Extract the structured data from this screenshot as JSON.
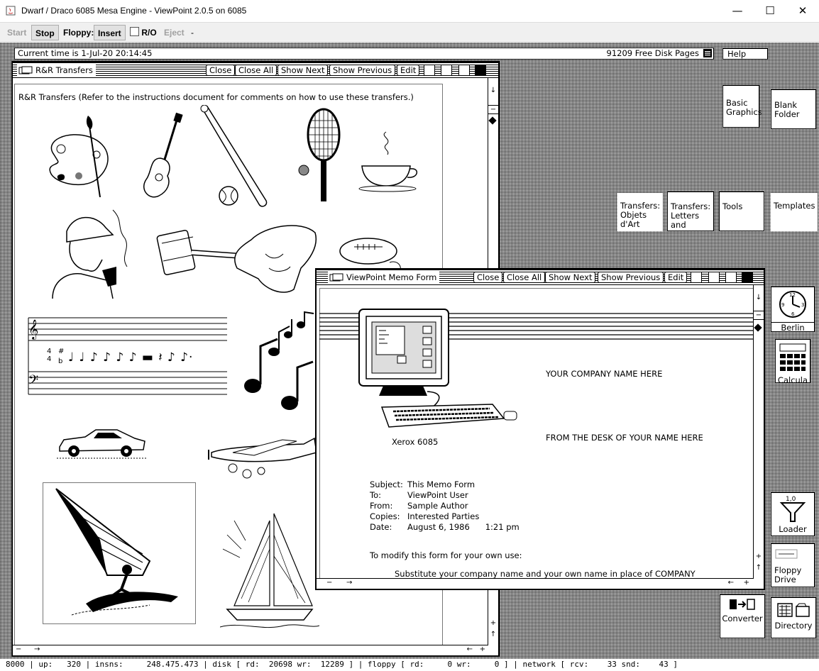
{
  "window": {
    "title": "Dwarf / Draco 6085 Mesa Engine - ViewPoint 2.0.5 on 6085",
    "controls": [
      "—",
      "☐",
      "✕"
    ]
  },
  "toolbar": {
    "start": "Start",
    "stop": "Stop",
    "floppy_label": "Floppy:",
    "insert": "Insert",
    "ro": "R/O",
    "eject": "Eject",
    "dash": "-"
  },
  "status": {
    "time": "Current time is 1-Jul-20 20:14:45",
    "disk": "91209 Free Disk Pages"
  },
  "help_tab": "Help",
  "rr_window": {
    "title": "R&R Transfers",
    "buttons": [
      "Close",
      "Close All",
      "Show Next",
      "Show Previous",
      "Edit"
    ],
    "heading": "R&R Transfers   (Refer to the instructions document for comments on how to use these transfers.)"
  },
  "memo_window": {
    "title": "ViewPoint Memo Form",
    "buttons": [
      "Close",
      "Close All",
      "Show Next",
      "Show Previous",
      "Edit"
    ],
    "company": "YOUR COMPANY NAME HERE",
    "from_desk": "FROM THE DESK OF YOUR NAME HERE",
    "caption": "Xerox 6085",
    "fields": [
      {
        "label": "Subject:",
        "value": "This Memo Form"
      },
      {
        "label": "To:",
        "value": "ViewPoint User"
      },
      {
        "label": "From:",
        "value": "Sample Author"
      },
      {
        "label": "Copies:",
        "value": "Interested Parties"
      },
      {
        "label": "Date:",
        "value": "August 6, 1986      1:21 pm"
      }
    ],
    "modify": "To modify this form for your own use:",
    "instruction": "Substitute your company name and your own name in place of COMPANY"
  },
  "desktop_icons": {
    "basic_graphics": "Basic Graphics",
    "blank_folder": "Blank Folder",
    "transfers_objets": "Transfers: Objets d'Art",
    "transfers_letters": "Transfers: Letters and",
    "tools": "Tools",
    "templates": "Templates",
    "berlin": "Berlin",
    "calcula": "Calcula",
    "loader": "Loader",
    "floppy_drive": "Floppy Drive",
    "converter": "Converter",
    "directory": "Directory"
  },
  "music": {
    "clef": "𝄞",
    "bass": "𝄢",
    "meter_top": "4",
    "meter_bottom": "4",
    "sharp": "#",
    "flat": "b",
    "notes": "♩ ♩ ♪ ♪ ♪ ♪  ▬  𝄽  ♪ ♪·"
  },
  "bottom_bar": "8000 | up:   320 | insns:     248.475.473 | disk [ rd:  20698 wr:  12289 ] | floppy [ rd:     0 wr:     0 ] | network [ rcv:    33 snd:    43 ]"
}
